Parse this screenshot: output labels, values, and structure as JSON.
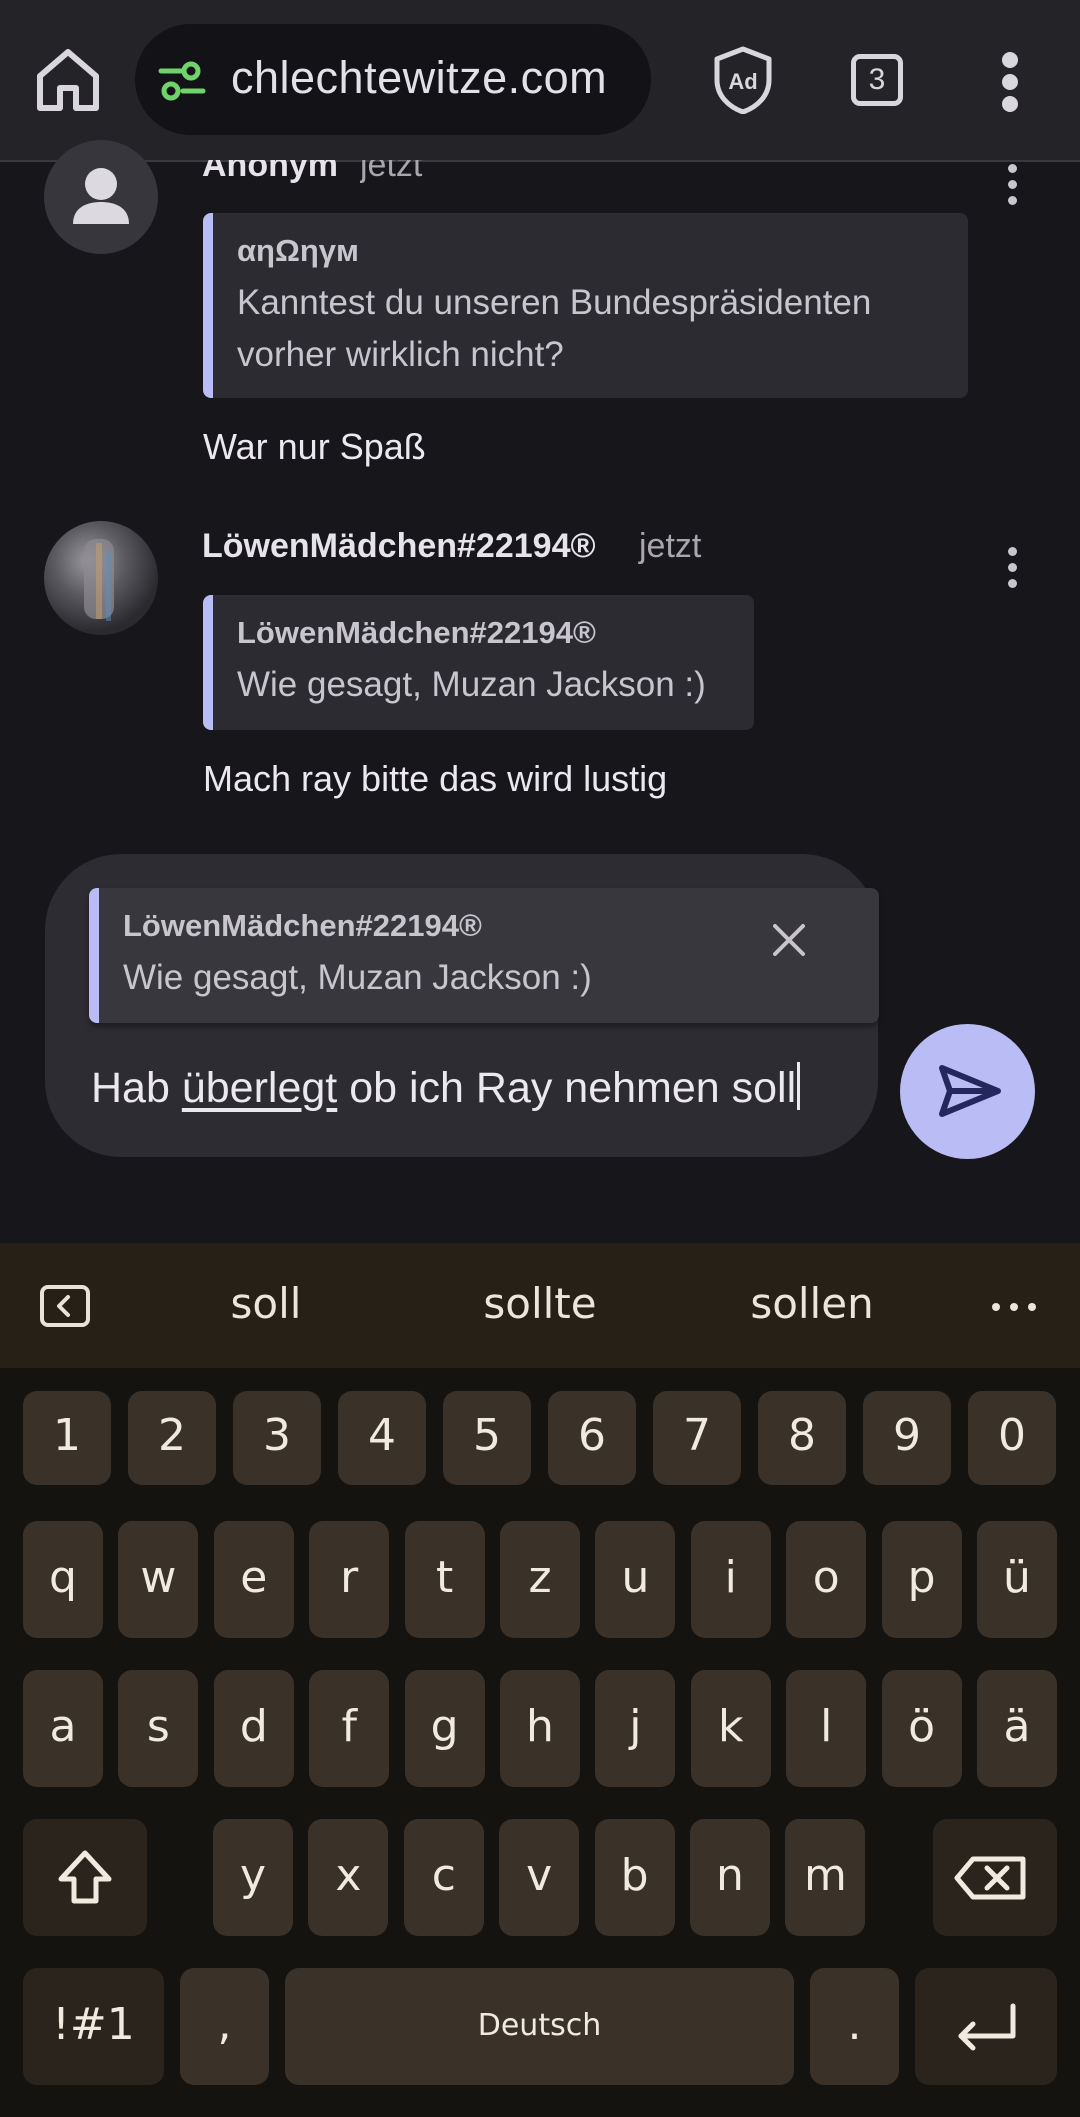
{
  "browser": {
    "url": "chlechtewitze.com",
    "tab_count": "3"
  },
  "comments": [
    {
      "author": "Anonym",
      "time": "jetzt",
      "quote_author": "αηΩηγм",
      "quote_lines": [
        "Kanntest du unseren Bundespräsidenten",
        "vorher wirklich nicht?"
      ],
      "text": "War nur Spaß"
    },
    {
      "author": "LöwenMädchen#22194®",
      "time": "jetzt",
      "quote_author": "LöwenMädchen#22194®",
      "quote_lines": [
        "Wie gesagt, Muzan Jackson :)"
      ],
      "text": "Mach ray bitte das wird lustig"
    }
  ],
  "composer": {
    "reply_to_author": "LöwenMädchen#22194®",
    "reply_to_text": "Wie gesagt, Muzan Jackson :)",
    "input_before": "Hab ",
    "input_underlined": "überlegt",
    "input_after": " ob ich Ray nehmen soll"
  },
  "keyboard": {
    "suggestions": [
      "soll",
      "sollte",
      "sollen"
    ],
    "number_row": [
      "1",
      "2",
      "3",
      "4",
      "5",
      "6",
      "7",
      "8",
      "9",
      "0"
    ],
    "row1": [
      "q",
      "w",
      "e",
      "r",
      "t",
      "z",
      "u",
      "i",
      "o",
      "p",
      "ü"
    ],
    "row2": [
      "a",
      "s",
      "d",
      "f",
      "g",
      "h",
      "j",
      "k",
      "l",
      "ö",
      "ä"
    ],
    "row3": [
      "y",
      "x",
      "c",
      "v",
      "b",
      "n",
      "m"
    ],
    "symbols_label": "!#1",
    "comma_label": ",",
    "space_label": "Deutsch",
    "period_label": "."
  },
  "colors": {
    "accent": "#b9bcf5",
    "background": "#17161b",
    "keyboard_key": "#3a3128"
  }
}
